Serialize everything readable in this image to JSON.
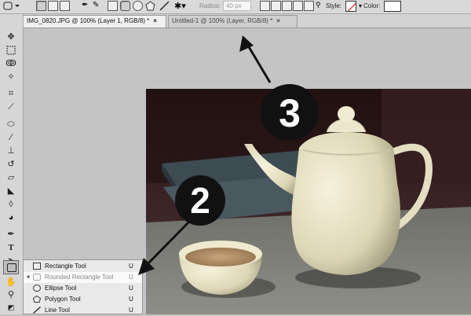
{
  "options_bar": {
    "radius_label": "Radius:",
    "radius_value": "40 px",
    "style_label": "Style:",
    "color_label": "Color:"
  },
  "tabs": [
    {
      "label": "IMG_0820.JPG @ 100% (Layer 1, RGB/8) *",
      "close": "×"
    },
    {
      "label": "Untitled-1 @ 100% (Layer, RGB/8) *",
      "close": "×"
    }
  ],
  "tools": [
    "move-tool",
    "marquee-tool",
    "lasso-tool",
    "magic-wand-tool",
    "crop-tool",
    "eyedropper-tool",
    "healing-brush-tool",
    "brush-tool",
    "clone-stamp-tool",
    "history-brush-tool",
    "eraser-tool",
    "paint-bucket-tool",
    "blur-tool",
    "dodge-tool",
    "pen-tool",
    "type-tool",
    "path-selection-tool",
    "shape-tool",
    "hand-tool",
    "zoom-tool"
  ],
  "flyout": {
    "items": [
      {
        "label": "Rectangle Tool",
        "key": "U",
        "current": false,
        "icon": "rectangle-icon"
      },
      {
        "label": "Rounded Rectangle Tool",
        "key": "U",
        "current": true,
        "icon": "rounded-rectangle-icon"
      },
      {
        "label": "Ellipse Tool",
        "key": "U",
        "current": false,
        "icon": "ellipse-icon"
      },
      {
        "label": "Polygon Tool",
        "key": "U",
        "current": false,
        "icon": "polygon-icon"
      },
      {
        "label": "Line Tool",
        "key": "U",
        "current": false,
        "icon": "line-icon"
      }
    ],
    "current_mark": "■"
  },
  "callouts": [
    {
      "number": "2"
    },
    {
      "number": "3"
    }
  ],
  "colors": {
    "accent_callout": "#111111",
    "style_swatch_slash": "#dd0000"
  }
}
